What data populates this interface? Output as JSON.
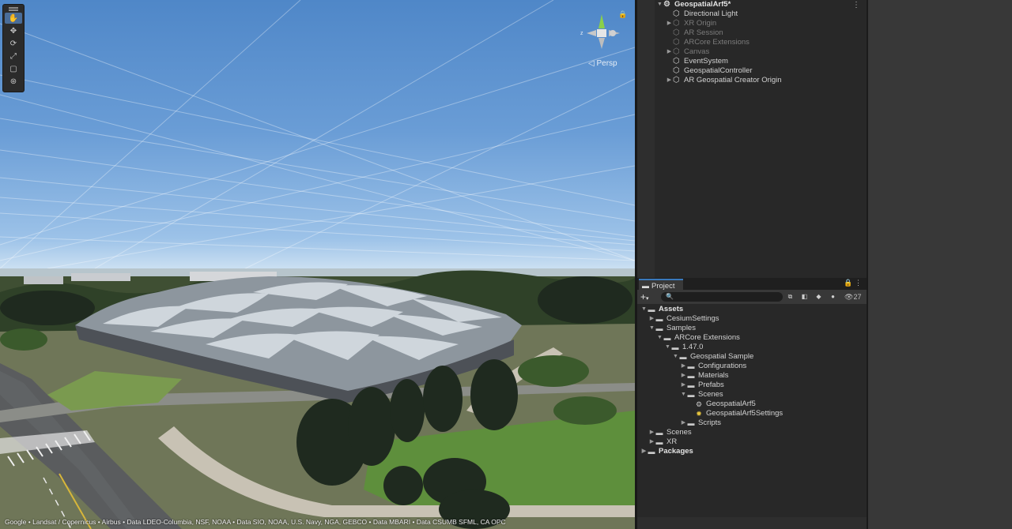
{
  "scene": {
    "persp_label": "Persp",
    "gizmo_z_label": "z",
    "attribution": "Google • Landsat / Copernicus • Airbus • Data LDEO-Columbia, NSF, NOAA • Data SIO, NOAA, U.S. Navy, NGA, GEBCO • Data MBARI • Data CSUMB SFML, CA OPC",
    "tools": [
      "hand-tool",
      "move-tool",
      "rotate-tool",
      "scale-tool",
      "rect-tool",
      "transform-tool"
    ]
  },
  "hierarchy": {
    "scene_name": "GeospatialArf5*",
    "items": [
      {
        "label": "Directional Light",
        "state": "active",
        "expandable": false
      },
      {
        "label": "XR Origin",
        "state": "inactive",
        "expandable": true
      },
      {
        "label": "AR Session",
        "state": "inactive",
        "expandable": false
      },
      {
        "label": "ARCore Extensions",
        "state": "inactive",
        "expandable": false
      },
      {
        "label": "Canvas",
        "state": "inactive",
        "expandable": true
      },
      {
        "label": "EventSystem",
        "state": "active",
        "expandable": false
      },
      {
        "label": "GeospatialController",
        "state": "active",
        "expandable": false
      },
      {
        "label": "AR Geospatial Creator Origin",
        "state": "active",
        "expandable": true
      }
    ]
  },
  "project": {
    "tab_label": "Project",
    "search_placeholder": "",
    "hidden_count": "27",
    "tree": [
      {
        "label": "Assets",
        "bold": true,
        "expanded": true
      },
      {
        "label": "CesiumSettings",
        "expanded": false
      },
      {
        "label": "Samples",
        "expanded": true
      },
      {
        "label": "ARCore Extensions",
        "expanded": true
      },
      {
        "label": "1.47.0",
        "expanded": true
      },
      {
        "label": "Geospatial Sample",
        "expanded": true
      },
      {
        "label": "Configurations",
        "expanded": false
      },
      {
        "label": "Materials",
        "expanded": false
      },
      {
        "label": "Prefabs",
        "expanded": false
      },
      {
        "label": "Scenes",
        "expanded": true
      },
      {
        "label": "GeospatialArf5",
        "type": "scene"
      },
      {
        "label": "GeospatialArf5Settings",
        "type": "settings"
      },
      {
        "label": "Scripts",
        "expanded": false
      },
      {
        "label": "Scenes",
        "expanded": false
      },
      {
        "label": "XR",
        "expanded": false
      },
      {
        "label": "Packages",
        "bold": true,
        "expanded": false
      }
    ]
  },
  "colors": {
    "panel_bg": "#282828",
    "toolbar_bg": "#383838",
    "accent": "#3a79bb",
    "active_tool": "#4a6d99"
  }
}
